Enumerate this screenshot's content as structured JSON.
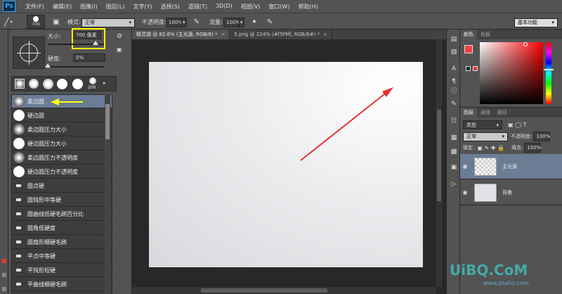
{
  "menubar": {
    "logo": "Ps",
    "items": [
      "文件(F)",
      "编辑(E)",
      "图像(I)",
      "图层(L)",
      "文字(Y)",
      "选择(S)",
      "滤镜(T)",
      "3D(D)",
      "视图(V)",
      "窗口(W)",
      "帮助(H)"
    ]
  },
  "options": {
    "brush_size": "700",
    "mode_label": "模式:",
    "mode_value": "正常",
    "opacity_label": "不透明度:",
    "opacity_value": "100%",
    "flow_label": "流量:",
    "flow_value": "100%",
    "workspace": "基本功能"
  },
  "brush_panel": {
    "size_label": "大小:",
    "size_value": "700 像素",
    "hardness_label": "硬度:",
    "hardness_value": "0%",
    "hardness": 0,
    "size_fraction": 0.85,
    "preset_size": "200",
    "brushes": [
      {
        "name": "柔边圆",
        "kind": "soft"
      },
      {
        "name": "硬边圆",
        "kind": "hard"
      },
      {
        "name": "柔边圆压力大小",
        "kind": "soft"
      },
      {
        "name": "硬边圆压力大小",
        "kind": "hard"
      },
      {
        "name": "柔边圆压力不透明度",
        "kind": "soft"
      },
      {
        "name": "硬边圆压力不透明度",
        "kind": "hard"
      },
      {
        "name": "圆点硬",
        "kind": "misc"
      },
      {
        "name": "圆钝形中等硬",
        "kind": "misc"
      },
      {
        "name": "圆曲线低硬毛刷百分比",
        "kind": "misc"
      },
      {
        "name": "圆角低硬度",
        "kind": "misc"
      },
      {
        "name": "圆扇形细硬毛刷",
        "kind": "misc"
      },
      {
        "name": "平点中等硬",
        "kind": "misc"
      },
      {
        "name": "平钝形短硬",
        "kind": "misc"
      },
      {
        "name": "平曲线细硬毛刷",
        "kind": "misc"
      }
    ]
  },
  "tabs": [
    {
      "label": "精灵球 @ 82.6% (主光源, RGB/8) *"
    },
    {
      "label": "5.png @ 224% (#f5f9ff, RGB/8#) *"
    }
  ],
  "colors": {
    "foreground": "#f04040",
    "background": "#ffffff",
    "highlight": "#ffff00",
    "selection": "#6b7c95"
  },
  "color_panel": {
    "tabs": [
      "颜色",
      "色板"
    ]
  },
  "layers_panel": {
    "tabs": [
      "图层",
      "通道",
      "路径"
    ],
    "filter": "类型",
    "blend": "正常",
    "opacity_label": "不透明度:",
    "opacity_value": "100%",
    "lock_label": "锁定:",
    "fill_label": "填充:",
    "fill_value": "100%",
    "layers": [
      {
        "name": "主光源",
        "selected": true
      },
      {
        "name": "背景",
        "selected": false
      }
    ]
  },
  "watermark": {
    "logo": "UiBQ.CoM",
    "sub": "www.psahz.com"
  }
}
